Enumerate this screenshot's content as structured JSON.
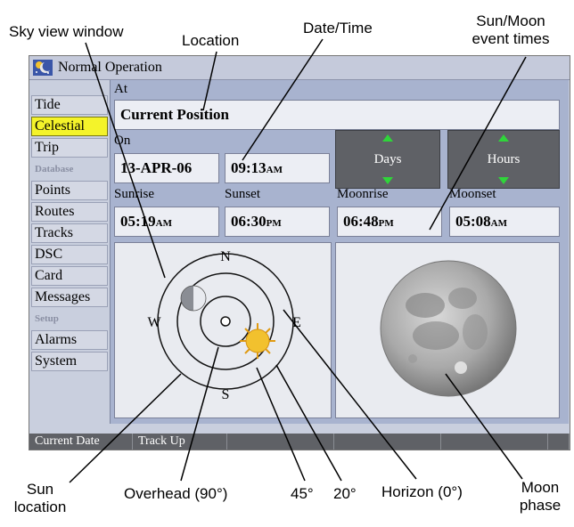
{
  "callouts": {
    "sky_view_window": "Sky view window",
    "location": "Location",
    "date_time": "Date/Time",
    "sun_moon_times_line1": "Sun/Moon",
    "sun_moon_times_line2": "event times",
    "sun_location_line1": "Sun",
    "sun_location_line2": "location",
    "overhead": "Overhead (90°)",
    "deg45": "45°",
    "deg20": "20°",
    "horizon": "Horizon (0°)",
    "moon_phase_line1": "Moon",
    "moon_phase_line2": "phase"
  },
  "window": {
    "title": "Normal Operation"
  },
  "sidebar": {
    "items": [
      {
        "label": "Tide",
        "active": false
      },
      {
        "label": "Celestial",
        "active": true
      },
      {
        "label": "Trip",
        "active": false
      },
      {
        "label": "Database",
        "section": true
      },
      {
        "label": "Points",
        "active": false
      },
      {
        "label": "Routes",
        "active": false
      },
      {
        "label": "Tracks",
        "active": false
      },
      {
        "label": "DSC",
        "active": false
      },
      {
        "label": "Card",
        "active": false
      },
      {
        "label": "Messages",
        "active": false
      },
      {
        "label": "Setup",
        "section": true
      },
      {
        "label": "Alarms",
        "active": false
      },
      {
        "label": "System",
        "active": false
      }
    ]
  },
  "main": {
    "at_label": "At",
    "location_value": "Current Position",
    "on_label": "On",
    "date_value": "13-APR-06",
    "time_value": "09:13",
    "time_suffix": "AM",
    "days_button": "Days",
    "hours_button": "Hours",
    "sunrise_label": "Sunrise",
    "sunset_label": "Sunset",
    "moonrise_label": "Moonrise",
    "moonset_label": "Moonset",
    "sunrise_time": "05:19",
    "sunrise_suffix": "AM",
    "sunset_time": "06:30",
    "sunset_suffix": "PM",
    "moonrise_time": "06:48",
    "moonrise_suffix": "PM",
    "moonset_time": "05:08",
    "moonset_suffix": "AM",
    "compass": {
      "north": "N",
      "south": "S",
      "east": "E",
      "west": "W"
    }
  },
  "softkeys": [
    "Current Date",
    "Track Up",
    "",
    "",
    "",
    ""
  ],
  "colors": {
    "active_tab": "#f4f32a",
    "button_bg": "#5f6166",
    "arrow_green": "#2fd53a",
    "sun": "#f2c12e"
  }
}
